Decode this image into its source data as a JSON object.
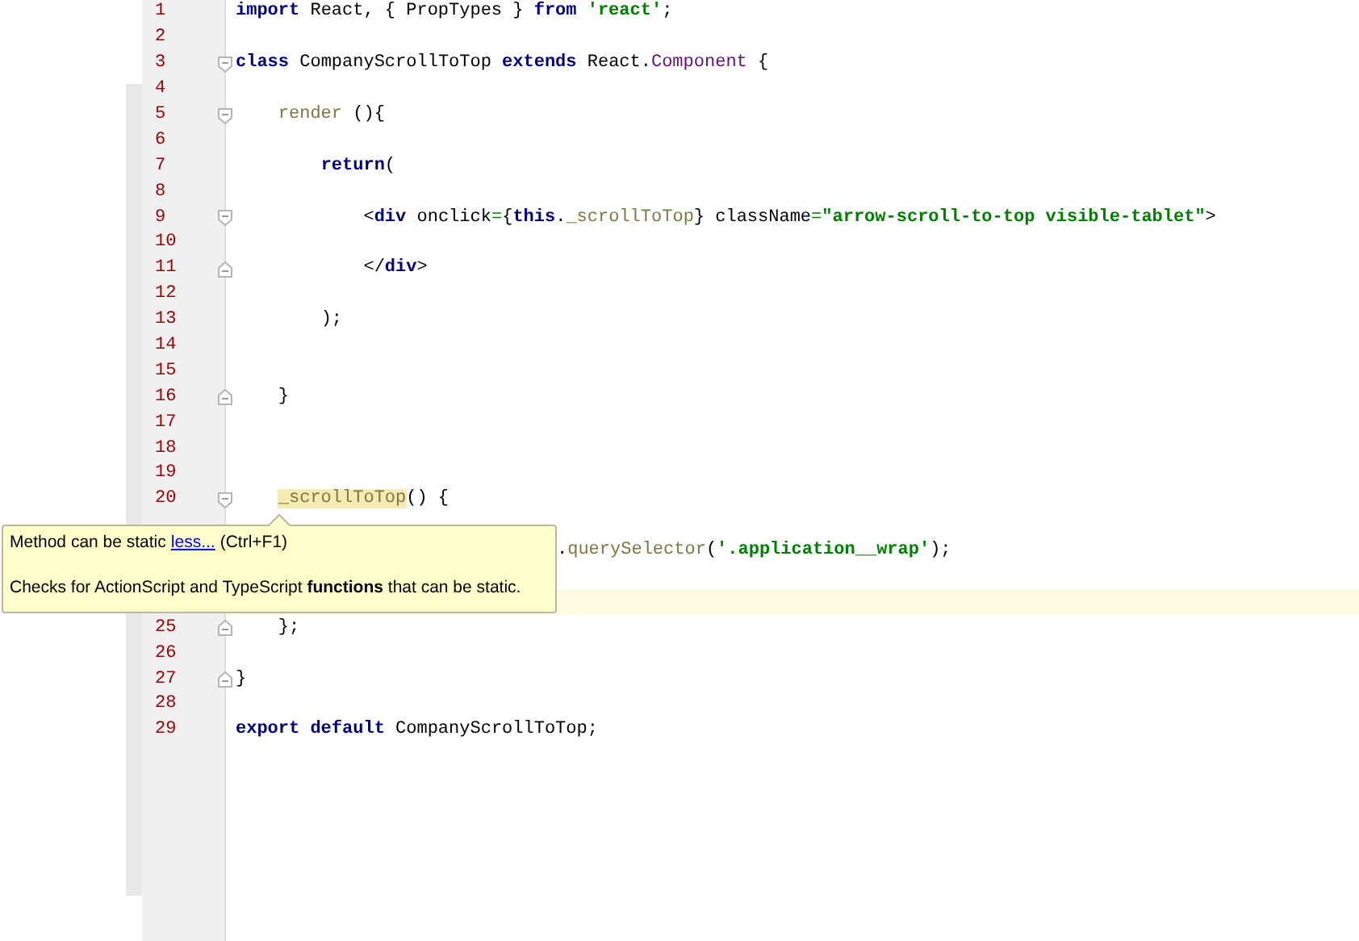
{
  "editor": {
    "lines": [
      {
        "number": "1",
        "current": false,
        "tokens": [
          {
            "text": "import",
            "kind": "keyword"
          },
          {
            "text": " React, { PropTypes } ",
            "kind": "plain"
          },
          {
            "text": "from",
            "kind": "keyword"
          },
          {
            "text": " 'react'",
            "kind": "string"
          },
          {
            "text": ";",
            "kind": "plain"
          }
        ]
      },
      {
        "number": "2",
        "current": false
      },
      {
        "number": "3",
        "current": false,
        "fold": {
          "kind": "start"
        },
        "tokens": [
          {
            "text": "class",
            "kind": "keyword"
          },
          {
            "text": " CompanyScrollToTop ",
            "kind": "plain"
          },
          {
            "text": "extends",
            "kind": "keyword"
          },
          {
            "text": " React.",
            "kind": "plain"
          },
          {
            "text": "Component",
            "kind": "class"
          },
          {
            "text": " {",
            "kind": "plain"
          }
        ]
      },
      {
        "number": "4",
        "current": false
      },
      {
        "number": "5",
        "current": false,
        "fold": {
          "kind": "start"
        },
        "tokens": [
          {
            "text": "    render",
            "kind": "method"
          },
          {
            "text": " (){",
            "kind": "plain"
          }
        ]
      },
      {
        "number": "6",
        "current": false
      },
      {
        "number": "7",
        "current": false,
        "tokens": [
          {
            "text": "        return",
            "kind": "keyword"
          },
          {
            "text": "(",
            "kind": "plain"
          }
        ]
      },
      {
        "number": "8",
        "current": false
      },
      {
        "number": "9",
        "current": false,
        "fold": {
          "kind": "start"
        },
        "tokens": [
          {
            "text": "            <",
            "kind": "plain"
          },
          {
            "text": "div",
            "kind": "keyword"
          },
          {
            "text": " onclick",
            "kind": "plain"
          },
          {
            "text": "=",
            "kind": "operator"
          },
          {
            "text": "{",
            "kind": "plain"
          },
          {
            "text": "this",
            "kind": "keyword"
          },
          {
            "text": ".",
            "kind": "plain"
          },
          {
            "text": "_scrollToTop",
            "kind": "method"
          },
          {
            "text": "} className",
            "kind": "plain"
          },
          {
            "text": "=",
            "kind": "operator"
          },
          {
            "text": "\"arrow-scroll-to-top visible-tablet\"",
            "kind": "string"
          },
          {
            "text": ">",
            "kind": "plain"
          }
        ]
      },
      {
        "number": "10",
        "current": false
      },
      {
        "number": "11",
        "current": false,
        "fold": {
          "kind": "end"
        },
        "tokens": [
          {
            "text": "            </",
            "kind": "plain"
          },
          {
            "text": "div",
            "kind": "keyword"
          },
          {
            "text": ">",
            "kind": "plain"
          }
        ]
      },
      {
        "number": "12",
        "current": false
      },
      {
        "number": "13",
        "current": false,
        "tokens": [
          {
            "text": "        );",
            "kind": "plain"
          }
        ]
      },
      {
        "number": "14",
        "current": false
      },
      {
        "number": "15",
        "current": false
      },
      {
        "number": "16",
        "current": false,
        "fold": {
          "kind": "end"
        },
        "tokens": [
          {
            "text": "    }",
            "kind": "plain"
          }
        ]
      },
      {
        "number": "17",
        "current": false
      },
      {
        "number": "18",
        "current": false
      },
      {
        "number": "19",
        "current": false
      },
      {
        "number": "20",
        "current": false,
        "fold": {
          "kind": "start"
        },
        "tokens": [
          {
            "text": "    _scrollToTop",
            "kind": "highlighted"
          },
          {
            "text": "() {",
            "kind": "plain"
          }
        ]
      },
      {
        "current": false
      },
      {
        "current": false,
        "partial": true,
        "tokens": [
          {
            "text": ".",
            "kind": "plain"
          },
          {
            "text": "querySelector",
            "kind": "method"
          },
          {
            "text": "(",
            "kind": "plain"
          },
          {
            "text": "'.application__wrap'",
            "kind": "string"
          },
          {
            "text": ");",
            "kind": "plain"
          }
        ]
      },
      {
        "current": false
      },
      {
        "current": true
      },
      {
        "number": "25",
        "current": false,
        "fold": {
          "kind": "end"
        },
        "tokens": [
          {
            "text": "    };",
            "kind": "plain"
          }
        ]
      },
      {
        "number": "26",
        "current": false
      },
      {
        "number": "27",
        "current": false,
        "fold": {
          "kind": "end"
        },
        "tokens": [
          {
            "text": "}",
            "kind": "plain"
          }
        ]
      },
      {
        "number": "28",
        "current": false
      },
      {
        "number": "29",
        "current": false,
        "tokens": [
          {
            "text": "export default",
            "kind": "keyword"
          },
          {
            "text": " CompanyScrollToTop;",
            "kind": "plain"
          }
        ]
      }
    ]
  },
  "tooltip": {
    "message": "Method can be static",
    "link": "less...",
    "shortcut": "(Ctrl+F1)",
    "description": "Checks for ActionScript and TypeScript **functions** that can be static."
  }
}
